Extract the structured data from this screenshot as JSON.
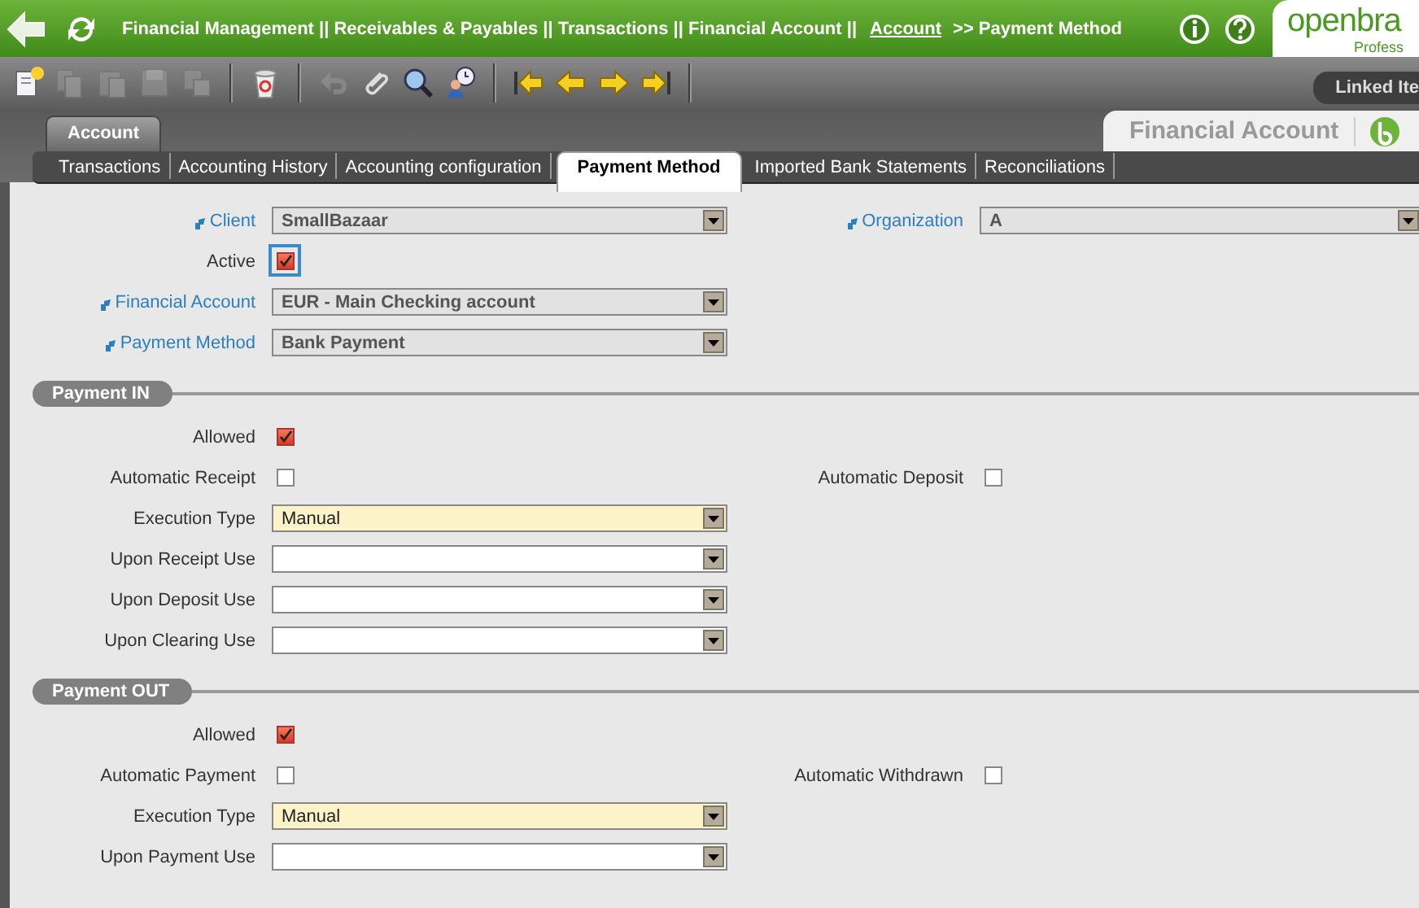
{
  "header": {
    "breadcrumb": "Financial Management || Receivables & Payables || Transactions || Financial Account  ||",
    "link": "Account",
    "current": ">> Payment Method",
    "logo": "openbra",
    "logo_sub": "Profess"
  },
  "toolbar": {
    "groups": [
      [
        {
          "kind": "new",
          "disabled": false
        },
        {
          "kind": "copy",
          "disabled": true
        },
        {
          "kind": "paste",
          "disabled": true
        },
        {
          "kind": "save",
          "disabled": true
        },
        {
          "kind": "revert",
          "disabled": true
        }
      ],
      [
        {
          "kind": "delete",
          "disabled": false
        }
      ],
      [
        {
          "kind": "undo",
          "disabled": true
        },
        {
          "kind": "attach",
          "disabled": false
        },
        {
          "kind": "search",
          "disabled": false
        },
        {
          "kind": "audit",
          "disabled": false
        }
      ],
      [
        {
          "kind": "first",
          "disabled": false
        },
        {
          "kind": "previous",
          "disabled": false
        },
        {
          "kind": "next",
          "disabled": false
        },
        {
          "kind": "last",
          "disabled": false
        }
      ]
    ],
    "linked": "Linked Ite"
  },
  "window_tab": "Account",
  "window_title": "Financial Account",
  "subtabs": [
    {
      "label": "Transactions",
      "selected": false
    },
    {
      "label": "Accounting History",
      "selected": false
    },
    {
      "label": "Accounting configuration",
      "selected": false
    },
    {
      "label": "Payment Method",
      "selected": true
    },
    {
      "label": "Imported Bank Statements",
      "selected": false
    },
    {
      "label": "Reconciliations",
      "selected": false
    }
  ],
  "sections": [
    {
      "rows": [
        [
          {
            "kind": "select",
            "label": "Client",
            "linked": true,
            "value": "SmallBazaar",
            "readonly": true,
            "required": false
          },
          {
            "kind": "select",
            "label": "Organization",
            "linked": true,
            "value": "A",
            "readonly": true,
            "required": false
          }
        ],
        [
          {
            "kind": "checkbox",
            "label": "Active",
            "checked": true,
            "focused": true
          }
        ],
        [
          {
            "kind": "select",
            "label": "Financial Account",
            "linked": true,
            "value": "EUR - Main Checking account",
            "readonly": true,
            "required": false
          }
        ],
        [
          {
            "kind": "select",
            "label": "Payment Method",
            "linked": true,
            "value": "Bank Payment",
            "readonly": true,
            "required": false
          }
        ]
      ]
    },
    {
      "title": "Payment IN",
      "rows": [
        [
          {
            "kind": "checkbox",
            "label": "Allowed",
            "checked": true,
            "focused": false
          }
        ],
        [
          {
            "kind": "checkbox",
            "label": "Automatic Receipt",
            "checked": false,
            "focused": false
          },
          {
            "kind": "checkbox",
            "label": "Automatic Deposit",
            "checked": false,
            "focused": false
          }
        ],
        [
          {
            "kind": "select",
            "label": "Execution Type",
            "linked": false,
            "value": "Manual",
            "readonly": false,
            "required": true
          }
        ],
        [
          {
            "kind": "select",
            "label": "Upon Receipt Use",
            "linked": false,
            "readonly": false,
            "required": false
          }
        ],
        [
          {
            "kind": "select",
            "label": "Upon Deposit Use",
            "linked": false,
            "readonly": false,
            "required": false
          }
        ],
        [
          {
            "kind": "select",
            "label": "Upon Clearing Use",
            "linked": false,
            "readonly": false,
            "required": false
          }
        ]
      ]
    },
    {
      "title": "Payment OUT",
      "rows": [
        [
          {
            "kind": "checkbox",
            "label": "Allowed",
            "checked": true,
            "focused": false
          }
        ],
        [
          {
            "kind": "checkbox",
            "label": "Automatic Payment",
            "checked": false,
            "focused": false
          },
          {
            "kind": "checkbox",
            "label": "Automatic Withdrawn",
            "checked": false,
            "focused": false
          }
        ],
        [
          {
            "kind": "select",
            "label": "Execution Type",
            "linked": false,
            "value": "Manual",
            "readonly": false,
            "required": true
          }
        ],
        [
          {
            "kind": "select",
            "label": "Upon Payment Use",
            "linked": false,
            "readonly": false,
            "required": false
          }
        ]
      ]
    }
  ]
}
